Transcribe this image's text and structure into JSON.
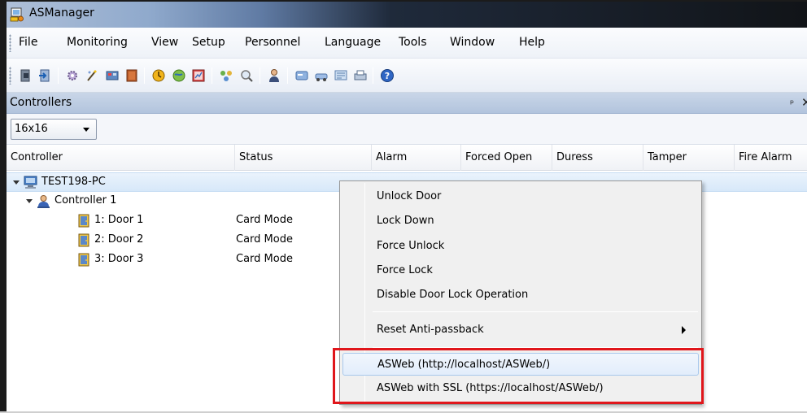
{
  "window": {
    "title": "ASManager"
  },
  "menu": [
    "File",
    "Monitoring",
    "View",
    "Setup",
    "Personnel",
    "Language",
    "Tools",
    "Window",
    "Help"
  ],
  "toolbar": {
    "icons": [
      "logout-icon",
      "login-icon",
      "settings-icon",
      "wizard-icon",
      "device-icon",
      "door-icon",
      "monitor-icon",
      "map-icon",
      "report-icon",
      "network-icon",
      "search-icon",
      "user-icon",
      "card-icon",
      "vehicle-icon",
      "log-icon",
      "print-icon",
      "help-icon"
    ]
  },
  "panel": {
    "title": "Controllers",
    "pin_glyph": "ᵖ",
    "close_glyph": "✕"
  },
  "filter": {
    "selected": "16x16"
  },
  "columns": [
    "Controller",
    "Status",
    "Alarm",
    "Forced Open",
    "Duress",
    "Tamper",
    "Fire Alarm"
  ],
  "tree": {
    "pc": "TEST198-PC",
    "controller": "Controller 1",
    "doors": [
      {
        "label": "1: Door 1",
        "status": "Card Mode"
      },
      {
        "label": "2: Door 2",
        "status": "Card Mode"
      },
      {
        "label": "3: Door 3",
        "status": "Card Mode"
      }
    ]
  },
  "context_menu": {
    "items": [
      "Unlock Door",
      "Lock Down",
      "Force Unlock",
      "Force Lock",
      "Disable Door Lock Operation",
      "Reset Anti-passback",
      "ASWeb (http://localhost/ASWeb/)",
      "ASWeb with SSL (https://localhost/ASWeb/)"
    ]
  },
  "colors": {
    "highlight": "#e0161b",
    "panel_header": "#b9cbe2",
    "selection": "#d7e8f9"
  }
}
